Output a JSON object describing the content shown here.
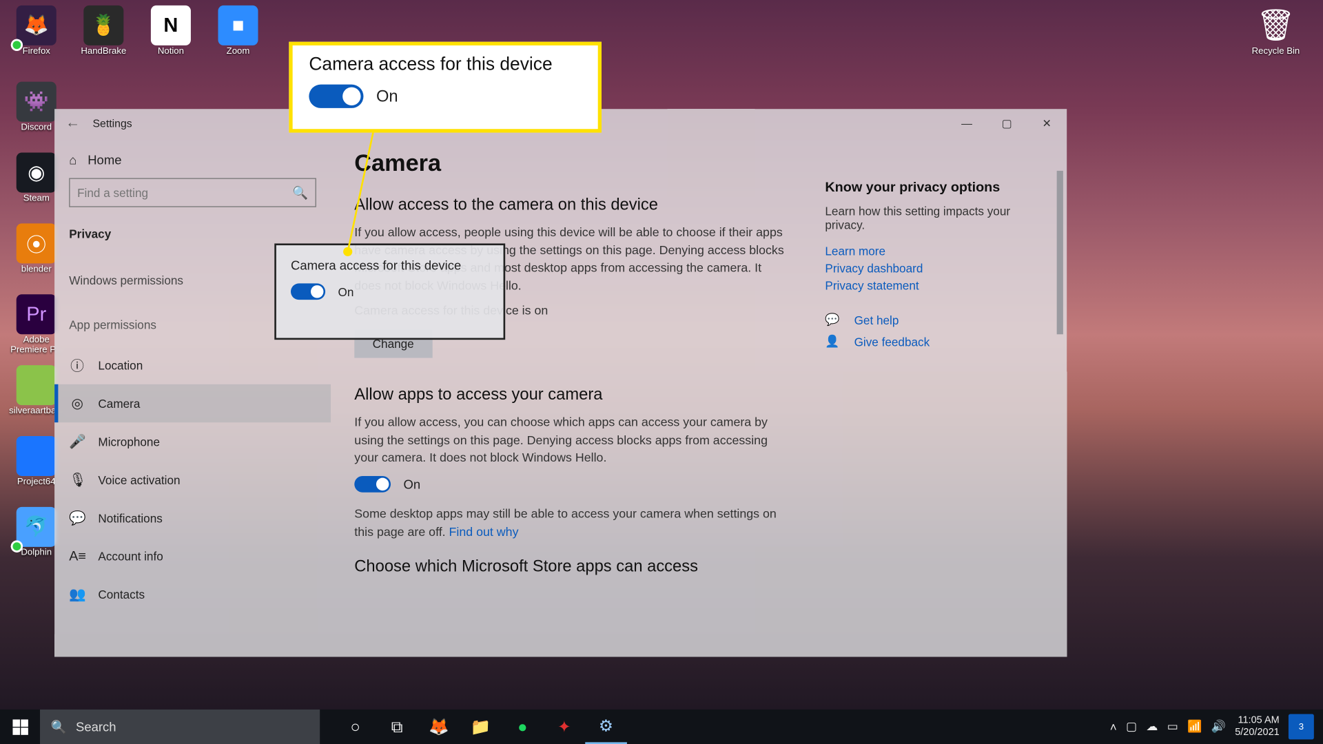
{
  "desktop": {
    "row1": [
      {
        "label": "Firefox",
        "cls": "ff",
        "glyph": "🦊"
      },
      {
        "label": "HandBrake",
        "cls": "hb",
        "glyph": "🍍"
      },
      {
        "label": "Notion",
        "cls": "no",
        "glyph": "N"
      },
      {
        "label": "Zoom",
        "cls": "zm",
        "glyph": "■"
      }
    ],
    "leftcol": [
      {
        "label": "Discord",
        "cls": "ds",
        "glyph": "👾"
      },
      {
        "label": "Steam",
        "cls": "st",
        "glyph": "◉"
      },
      {
        "label": "blender",
        "cls": "bl",
        "glyph": "⦿"
      },
      {
        "label": "Adobe Premiere P...",
        "cls": "ap",
        "glyph": "Pr"
      },
      {
        "label": "silveraartba...",
        "cls": "sa",
        "glyph": ""
      },
      {
        "label": "Project64",
        "cls": "p64",
        "glyph": ""
      },
      {
        "label": "Dolphin",
        "cls": "dl",
        "glyph": "🐬"
      }
    ],
    "recycle": {
      "label": "Recycle Bin",
      "glyph": "🗑"
    }
  },
  "callout": {
    "title": "Camera access for this device",
    "state": "On"
  },
  "popsmall": {
    "title": "Camera access for this device",
    "state": "On"
  },
  "window": {
    "title": "Settings",
    "home": "Home",
    "search_placeholder": "Find a setting",
    "cat_privacy": "Privacy",
    "cat_winperm": "Windows permissions",
    "cat_appperm": "App permissions",
    "items": [
      {
        "icon": "ⓘ",
        "label": "Location"
      },
      {
        "icon": "◎",
        "label": "Camera"
      },
      {
        "icon": "🎤",
        "label": "Microphone"
      },
      {
        "icon": "🎙",
        "label": "Voice activation"
      },
      {
        "icon": "💬",
        "label": "Notifications"
      },
      {
        "icon": "A≡",
        "label": "Account info"
      },
      {
        "icon": "👥",
        "label": "Contacts"
      }
    ],
    "page": {
      "h1": "Camera",
      "s1": "Allow access to the camera on this device",
      "p1": "If you allow access, people using this device will be able to choose if their apps have camera access by using the settings on this page. Denying access blocks Microsoft Store apps and most desktop apps from accessing the camera. It does not block Windows Hello.",
      "status": "Camera access for this device is on",
      "change": "Change",
      "s2": "Allow apps to access your camera",
      "p2": "If you allow access, you can choose which apps can access your camera by using the settings on this page. Denying access blocks apps from accessing your camera. It does not block Windows Hello.",
      "toggle2": "On",
      "p3a": "Some desktop apps may still be able to access your camera when settings on this page are off. ",
      "p3link": "Find out why",
      "s3": "Choose which Microsoft Store apps can access"
    },
    "aside": {
      "h": "Know your privacy options",
      "p": "Learn how this setting impacts your privacy.",
      "links": [
        "Learn more",
        "Privacy dashboard",
        "Privacy statement"
      ],
      "help": "Get help",
      "feedback": "Give feedback"
    }
  },
  "taskbar": {
    "search": "Search",
    "time": "11:05 AM",
    "date": "5/20/2021",
    "notif": "3"
  }
}
